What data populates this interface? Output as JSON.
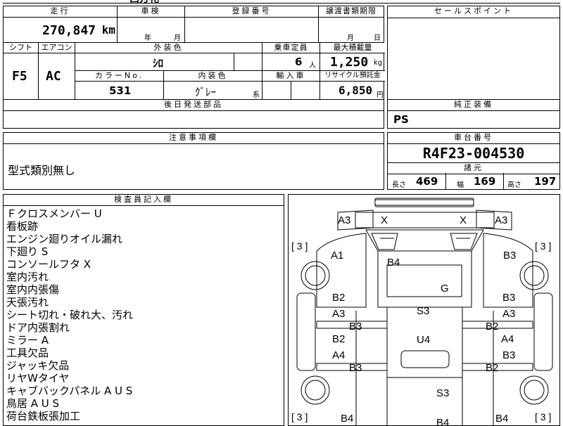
{
  "top_strip": "西方礼",
  "row1": {
    "mileage_header": "走行",
    "mileage_value": "270,847",
    "mileage_unit": "km",
    "inspection_header": "車検",
    "inspection_year": "年",
    "inspection_month": "月",
    "registration_header": "登録番号",
    "transfer_header": "譲渡書類期限",
    "transfer_month": "月",
    "transfer_day": "日"
  },
  "row2": {
    "shift_header": "シフト",
    "shift_value": "F5",
    "aircon_header": "エアコン",
    "aircon_value": "AC",
    "exterior_color_header": "外装色",
    "exterior_color_value": "ｼﾛ",
    "capacity_header": "乗車定員",
    "capacity_value": "6",
    "capacity_unit": "人",
    "max_load_header": "最大積載量",
    "max_load_value": "1,250",
    "max_load_unit": "kg",
    "color_no_header": "カラーNo.",
    "color_no_value": "531",
    "interior_color_header": "内装色",
    "interior_color_value": "ｸﾞﾚｰ",
    "interior_color_suffix": "系",
    "import_header": "輸入車",
    "recycle_header": "リサイクル預託金",
    "recycle_value": "6,850",
    "recycle_unit": "円"
  },
  "later_parts_header": "後日発送部品",
  "sales_point_header": "セールスポイント",
  "genuine_equipment_header": "純正装備",
  "genuine_equipment_value": "PS",
  "caution_header": "注意事項欄",
  "caution_value": "型式類別無し",
  "chassis_header": "車台番号",
  "chassis_value": "R4F23-004530",
  "specs_header": "諸元",
  "specs": {
    "length_label": "長さ",
    "length_value": "469",
    "width_label": "幅",
    "width_value": "169",
    "height_label": "高さ",
    "height_value": "197"
  },
  "inspector_header": "検査員記入欄",
  "inspector_notes": [
    "Ｆクロスメンバー U",
    "看板跡",
    "エンジン廻りオイル漏れ",
    "下廻り S",
    "コンソールフタ X",
    "室内汚れ",
    "室内内張傷",
    "天張汚れ",
    "シート切れ・破れ大、汚れ",
    "ドア内張割れ",
    "ミラー A",
    "工具欠品",
    "ジャッキ欠品",
    "リヤWタイヤ",
    "キャブバックパネル A U S",
    "鳥居 A U S",
    "荷台鉄板張加工"
  ],
  "tire_labels": {
    "fl": "[ 3 ]",
    "fr": "[ 3 ]",
    "rl": "[ 3 ]",
    "rr": "[ 3 ]"
  },
  "diagram_marks": {
    "a3_left": "A3",
    "x_left": "X",
    "x_right": "X",
    "a3_right": "A3",
    "a1": "A1",
    "b4_top": "B4",
    "b3_right_top": "B3",
    "g": "G",
    "b2_left": "B2",
    "b3_right_2": "B3",
    "a3_left_2": "A3",
    "s3_top": "S3",
    "a3_right_2": "A3",
    "b3_mid_left": "B3",
    "b2_mid_right": "B2",
    "b2_left_2": "B2",
    "u4": "U4",
    "a4_right": "A4",
    "a4_left": "A4",
    "b3_right_3": "B3",
    "b3_low_left": "B3",
    "b2_low_right": "B2",
    "s3_bottom": "S3",
    "b4_bl": "B4",
    "b4_bc": "B4",
    "b4_br": "B4"
  }
}
